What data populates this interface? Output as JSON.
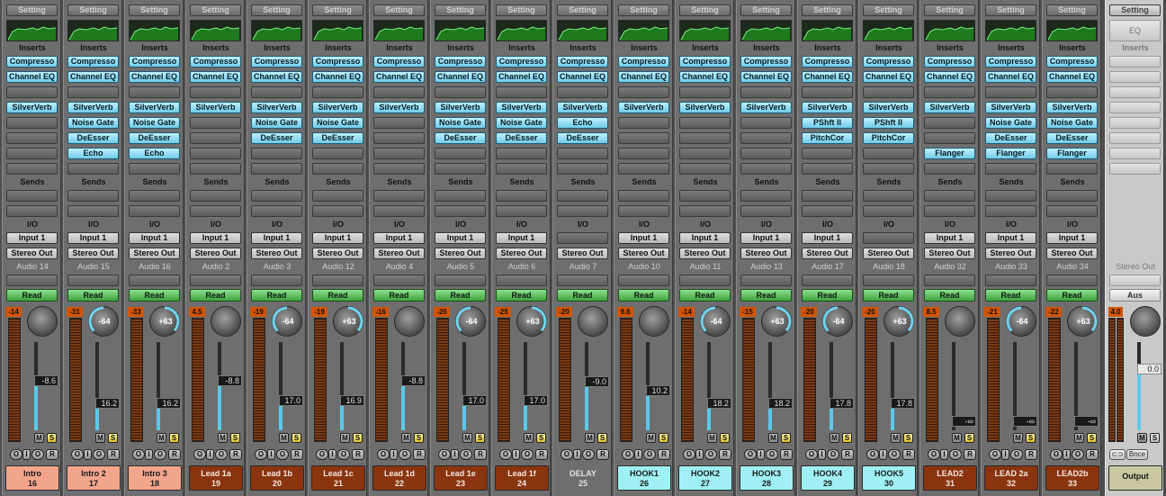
{
  "labels": {
    "setting": "Setting",
    "inserts": "Inserts",
    "sends": "Sends",
    "io": "I/O",
    "read": "Read",
    "mute": "M",
    "solo": "S",
    "o": "O",
    "i": "I",
    "r": "R",
    "eq": "EQ",
    "stereo_out": "Stereo Out",
    "aus": "Aus",
    "bnce": "Bnce",
    "link_icon": "link-icon"
  },
  "colors": {
    "intro": "#f3a58c",
    "lead": "#8a3410",
    "delay": "#6e6e6e",
    "hook": "#9ff0f5",
    "output": "#c9c7a0"
  },
  "channels": [
    {
      "name": "Intro",
      "number": "16",
      "track": "Audio 14",
      "input": "Input 1",
      "output": "Stereo Out",
      "eq": [
        "Compresso",
        "Channel EQ"
      ],
      "fx": [
        "SilverVerb",
        "",
        "",
        ""
      ],
      "peak": "-14",
      "knob": "",
      "fader": "-8.6",
      "fader_level": 0.57,
      "color": "intro"
    },
    {
      "name": "Intro 2",
      "number": "17",
      "track": "Audio 15",
      "input": "Input 1",
      "output": "Stereo Out",
      "eq": [
        "Compresso",
        "Channel EQ"
      ],
      "fx": [
        "SilverVerb",
        "Noise Gate",
        "DeEsser",
        "Echo"
      ],
      "peak": "-31",
      "knob": "-64",
      "fader": "16.2",
      "fader_level": 0.28,
      "color": "intro"
    },
    {
      "name": "Intro 3",
      "number": "18",
      "track": "Audio 16",
      "input": "Input 1",
      "output": "Stereo Out",
      "eq": [
        "Compresso",
        "Channel EQ"
      ],
      "fx": [
        "SilverVerb",
        "Noise Gate",
        "DeEsser",
        "Echo"
      ],
      "peak": "-33",
      "knob": "+63",
      "fader": "16.2",
      "fader_level": 0.28,
      "color": "intro"
    },
    {
      "name": "Lead 1a",
      "number": "19",
      "track": "Audio 2",
      "input": "Input 1",
      "output": "Stereo Out",
      "eq": [
        "Compresso",
        "Channel EQ"
      ],
      "fx": [
        "SilverVerb",
        "",
        "",
        ""
      ],
      "peak": "4.5",
      "knob": "",
      "fader": "-8.8",
      "fader_level": 0.57,
      "color": "lead"
    },
    {
      "name": "Lead 1b",
      "number": "20",
      "track": "Audio 3",
      "input": "Input 1",
      "output": "Stereo Out",
      "eq": [
        "Compresso",
        "Channel EQ"
      ],
      "fx": [
        "SilverVerb",
        "Noise Gate",
        "DeEsser",
        ""
      ],
      "peak": "-19",
      "knob": "-64",
      "fader": "17.0",
      "fader_level": 0.31,
      "color": "lead"
    },
    {
      "name": "Lead 1c",
      "number": "21",
      "track": "Audio 12",
      "input": "Input 1",
      "output": "Stereo Out",
      "eq": [
        "Compresso",
        "Channel EQ"
      ],
      "fx": [
        "SilverVerb",
        "Noise Gate",
        "DeEsser",
        ""
      ],
      "peak": "-19",
      "knob": "+63",
      "fader": "16.9",
      "fader_level": 0.31,
      "color": "lead"
    },
    {
      "name": "Lead 1d",
      "number": "22",
      "track": "Audio 4",
      "input": "Input 1",
      "output": "Stereo Out",
      "eq": [
        "Compresso",
        "Channel EQ"
      ],
      "fx": [
        "SilverVerb",
        "",
        "",
        ""
      ],
      "peak": "-16",
      "knob": "",
      "fader": "-8.8",
      "fader_level": 0.57,
      "color": "lead"
    },
    {
      "name": "Lead 1e",
      "number": "23",
      "track": "Audio 5",
      "input": "Input 1",
      "output": "Stereo Out",
      "eq": [
        "Compresso",
        "Channel EQ"
      ],
      "fx": [
        "SilverVerb",
        "Noise Gate",
        "DeEsser",
        ""
      ],
      "peak": "-26",
      "knob": "-64",
      "fader": "17.0",
      "fader_level": 0.31,
      "color": "lead"
    },
    {
      "name": "Lead 1f",
      "number": "24",
      "track": "Audio 6",
      "input": "Input 1",
      "output": "Stereo Out",
      "eq": [
        "Compresso",
        "Channel EQ"
      ],
      "fx": [
        "SilverVerb",
        "Noise Gate",
        "DeEsser",
        ""
      ],
      "peak": "-25",
      "knob": "+63",
      "fader": "17.0",
      "fader_level": 0.31,
      "color": "lead"
    },
    {
      "name": "DELAY",
      "number": "25",
      "track": "Audio 7",
      "input": "",
      "output": "Stereo Out",
      "eq": [
        "Compresso",
        "Channel EQ"
      ],
      "fx": [
        "SilverVerb",
        "Echo",
        "DeEsser",
        ""
      ],
      "peak": "-20",
      "knob": "",
      "fader": "-9.0",
      "fader_level": 0.56,
      "color": "delay"
    },
    {
      "name": "HOOK1",
      "number": "26",
      "track": "Audio 10",
      "input": "Input 1",
      "output": "Stereo Out",
      "eq": [
        "Compresso",
        "Channel EQ"
      ],
      "fx": [
        "SilverVerb",
        "",
        "",
        ""
      ],
      "peak": "9.6",
      "knob": "",
      "fader": "10.2",
      "fader_level": 0.44,
      "color": "hook"
    },
    {
      "name": "HOOK2",
      "number": "27",
      "track": "Audio 11",
      "input": "Input 1",
      "output": "Stereo Out",
      "eq": [
        "Compresso",
        "Channel EQ"
      ],
      "fx": [
        "SilverVerb",
        "",
        "",
        ""
      ],
      "peak": "-14",
      "knob": "-64",
      "fader": "18.2",
      "fader_level": 0.28,
      "color": "hook"
    },
    {
      "name": "HOOK3",
      "number": "28",
      "track": "Audio 13",
      "input": "Input 1",
      "output": "Stereo Out",
      "eq": [
        "Compresso",
        "Channel EQ"
      ],
      "fx": [
        "SilverVerb",
        "",
        "",
        ""
      ],
      "peak": "-15",
      "knob": "+63",
      "fader": "18.2",
      "fader_level": 0.28,
      "color": "hook"
    },
    {
      "name": "HOOK4",
      "number": "29",
      "track": "Audio 17",
      "input": "Input 1",
      "output": "Stereo Out",
      "eq": [
        "Compresso",
        "Channel EQ"
      ],
      "fx": [
        "SilverVerb",
        "PShft II",
        "PitchCor",
        ""
      ],
      "peak": "-20",
      "knob": "-64",
      "fader": "17.8",
      "fader_level": 0.28,
      "color": "hook"
    },
    {
      "name": "HOOK5",
      "number": "30",
      "track": "Audio 18",
      "input": "",
      "output": "Stereo Out",
      "eq": [
        "Compresso",
        "Channel EQ"
      ],
      "fx": [
        "SilverVerb",
        "PShft II",
        "PitchCor",
        ""
      ],
      "peak": "-20",
      "knob": "+63",
      "fader": "17.8",
      "fader_level": 0.28,
      "color": "hook"
    },
    {
      "name": "LEAD2",
      "number": "31",
      "track": "Audio 32",
      "input": "Input 1",
      "output": "Stereo Out",
      "eq": [
        "Compresso",
        "Channel EQ"
      ],
      "fx": [
        "SilverVerb",
        "",
        "",
        "Flanger"
      ],
      "peak": "8.5",
      "knob": "",
      "fader": "-∞",
      "fader_level": 0.0,
      "color": "lead"
    },
    {
      "name": "LEAD 2a",
      "number": "32",
      "track": "Audio 33",
      "input": "Input 1",
      "output": "Stereo Out",
      "eq": [
        "Compresso",
        "Channel EQ"
      ],
      "fx": [
        "SilverVerb",
        "Noise Gate",
        "DeEsser",
        "Flanger"
      ],
      "peak": "-21",
      "knob": "-64",
      "fader": "-∞",
      "fader_level": 0.0,
      "color": "lead"
    },
    {
      "name": "LEAD2b",
      "number": "33",
      "track": "Audio 34",
      "input": "Input 1",
      "output": "Stereo Out",
      "eq": [
        "Compresso",
        "Channel EQ"
      ],
      "fx": [
        "SilverVerb",
        "Noise Gate",
        "DeEsser",
        "Flanger"
      ],
      "peak": "-22",
      "knob": "+63",
      "fader": "-∞",
      "fader_level": 0.0,
      "color": "lead"
    }
  ],
  "master": {
    "name": "Output",
    "track": "Stereo Out",
    "peak": "4.0",
    "fader": "0.0",
    "fader_level": 0.72
  }
}
